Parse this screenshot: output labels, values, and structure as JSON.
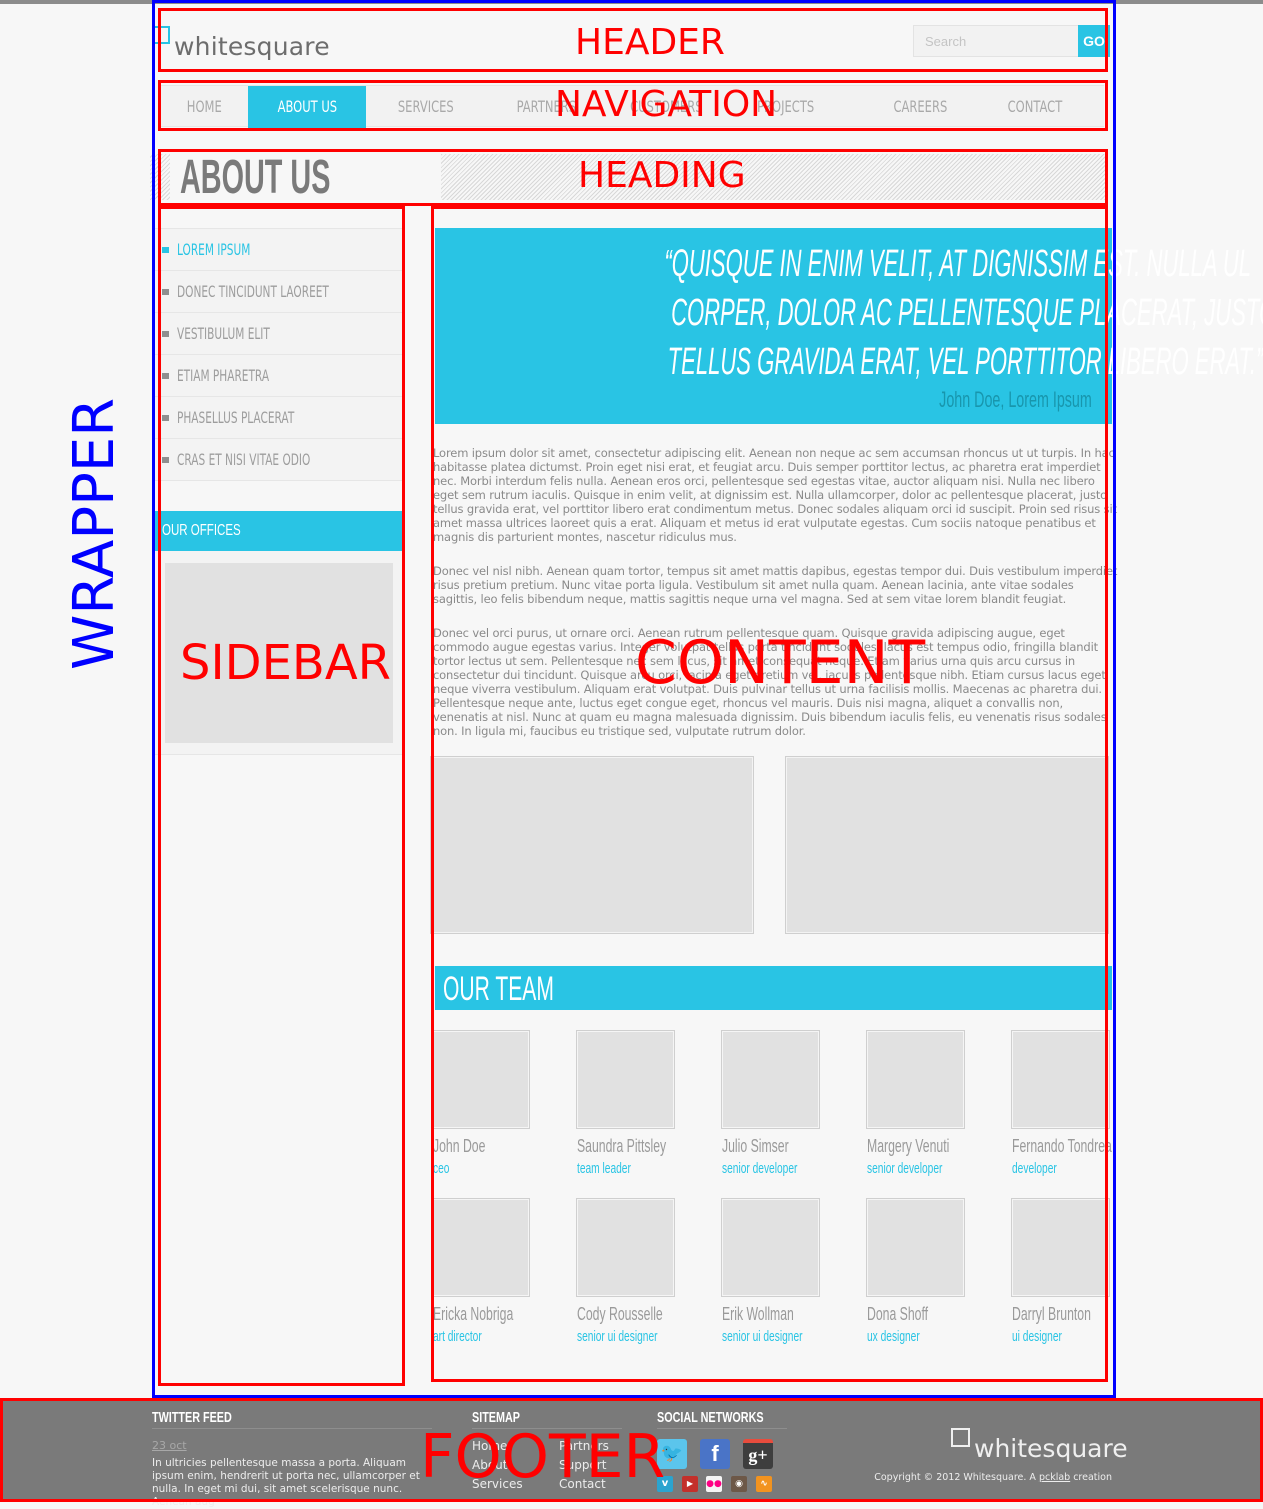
{
  "annotations": {
    "header": "HEADER",
    "navigation": "NAVIGATION",
    "heading": "HEADING",
    "sidebar": "SIDEBAR",
    "content": "CONTENT",
    "wrapper": "WRAPPER",
    "footer": "FOOTER"
  },
  "header": {
    "logo_text": "whitesquare",
    "search_placeholder": "Search",
    "search_button": "GO"
  },
  "nav": {
    "items": [
      {
        "label": "HOME",
        "active": false
      },
      {
        "label": "ABOUT US",
        "active": true
      },
      {
        "label": "SERVICES",
        "active": false
      },
      {
        "label": "PARTNERS",
        "active": false
      },
      {
        "label": "CUSTOMERS",
        "active": false
      },
      {
        "label": "PROJECTS",
        "active": false
      },
      {
        "label": "CAREERS",
        "active": false
      },
      {
        "label": "CONTACT",
        "active": false
      }
    ]
  },
  "heading": {
    "title": "ABOUT US"
  },
  "sidebar": {
    "items": [
      {
        "label": "LOREM IPSUM",
        "active": true
      },
      {
        "label": "DONEC TINCIDUNT LAOREET",
        "active": false
      },
      {
        "label": "VESTIBULUM ELIT",
        "active": false
      },
      {
        "label": "ETIAM PHARETRA",
        "active": false
      },
      {
        "label": "PHASELLUS PLACERAT",
        "active": false
      },
      {
        "label": "CRAS ET NISI VITAE ODIO",
        "active": false
      }
    ],
    "offices_title": "OUR OFFICES"
  },
  "content": {
    "quote": {
      "lines": [
        "“QUISQUE IN ENIM VELIT, AT DIGNISSIM EST. NULLA UL",
        "CORPER, DOLOR AC PELLENTESQUE PLACERAT, JUSTO",
        "TELLUS GRAVIDA ERAT, VEL PORTTITOR LIBERO ERAT.”"
      ],
      "author": "John Doe, Lorem Ipsum"
    },
    "paragraphs": [
      "Lorem ipsum dolor sit amet, consectetur adipiscing elit. Aenean non neque ac sem accumsan rhoncus ut ut turpis. In hac habitasse platea dictumst. Proin eget nisi erat, et feugiat arcu. Duis semper porttitor lectus, ac pharetra erat imperdiet nec. Morbi interdum felis nulla. Aenean eros orci, pellentesque sed egestas vitae, auctor aliquam nisi. Nulla nec libero eget sem rutrum iaculis. Quisque in enim velit, at dignissim est. Nulla ullamcorper, dolor ac pellentesque placerat, justo tellus gravida erat, vel porttitor libero erat condimentum metus. Donec sodales aliquam orci id suscipit. Proin sed risus sit amet massa ultrices laoreet quis a erat. Aliquam et metus id erat vulputate egestas. Cum sociis natoque penatibus et magnis dis parturient montes, nascetur ridiculus mus.",
      "Donec vel nisl nibh. Aenean quam tortor, tempus sit amet mattis dapibus, egestas tempor dui. Duis vestibulum imperdiet risus pretium pretium. Nunc vitae porta ligula. Vestibulum sit amet nulla quam. Aenean lacinia, ante vitae sodales sagittis, leo felis bibendum neque, mattis sagittis neque urna vel magna. Sed at sem vitae lorem blandit feugiat.",
      "Donec vel orci purus, ut ornare orci. Aenean rutrum pellentesque quam. Quisque gravida adipiscing augue, eget commodo augue egestas varius. Integer volutpat tellus porta tincidunt sodales, lacus est tempus odio, fringilla blandit tortor lectus ut sem. Pellentesque nec sem lacus, sit amet consequat neque. Etiam varius urna quis arcu cursus in consectetur dui tincidunt. Quisque arcu orci, lacinia eget pretium vel, iaculis pellentesque nibh. Etiam cursus lacus eget neque viverra vestibulum. Aliquam erat volutpat. Duis pulvinar tellus ut urna facilisis mollis. Maecenas ac pharetra dui. Pellentesque neque ante, luctus eget congue eget, rhoncus vel mauris. Duis nisi magna, aliquet a convallis non, venenatis at nisl. Nunc at quam eu magna malesuada dignissim. Duis bibendum iaculis felis, eu venenatis risus sodales non. In ligula mi, faucibus eu tristique sed, vulputate rutrum dolor."
    ],
    "team_title": "OUR TEAM",
    "team": [
      {
        "name": "John Doe",
        "role": "ceo"
      },
      {
        "name": "Saundra Pittsley",
        "role": "team leader"
      },
      {
        "name": "Julio Simser",
        "role": "senior developer"
      },
      {
        "name": "Margery Venuti",
        "role": "senior developer"
      },
      {
        "name": "Fernando Tondrea",
        "role": "developer"
      },
      {
        "name": "Ericka Nobriga",
        "role": "art director"
      },
      {
        "name": "Cody Rousselle",
        "role": "senior ui designer"
      },
      {
        "name": "Erik Wollman",
        "role": "senior ui designer"
      },
      {
        "name": "Dona Shoff",
        "role": "ux designer"
      },
      {
        "name": "Darryl Brunton",
        "role": "ui designer"
      }
    ]
  },
  "footer": {
    "twitter": {
      "title": "TWITTER FEED",
      "date": "23 oct",
      "tweet": "In ultricies pellentesque massa a porta. Aliquam ipsum enim, hendrerit ut porta nec, ullamcorper et nulla. In eget mi dui, sit amet scelerisque nunc. Aenean aug"
    },
    "sitemap": {
      "title": "SITEMAP",
      "col1": [
        "Home",
        "About",
        "Services"
      ],
      "col2": [
        "Partners",
        "Support",
        "Contact"
      ]
    },
    "social": {
      "title": "SOCIAL NETWORKS",
      "big_icons": [
        "twitter",
        "facebook",
        "google-plus"
      ],
      "small_icons": [
        "vimeo",
        "youtube",
        "flickr",
        "instagram",
        "rss"
      ]
    },
    "logo_text": "whitesquare",
    "copyright_prefix": "Copyright © 2012 Whitesquare. A ",
    "copyright_link": "pcklab",
    "copyright_suffix": " creation"
  },
  "colors": {
    "accent": "#29c4e4",
    "footer_bg": "#7a7a7a",
    "page_bg": "#f7f7f7",
    "annotation_red": "#ff0000",
    "annotation_blue": "#0000ff"
  }
}
